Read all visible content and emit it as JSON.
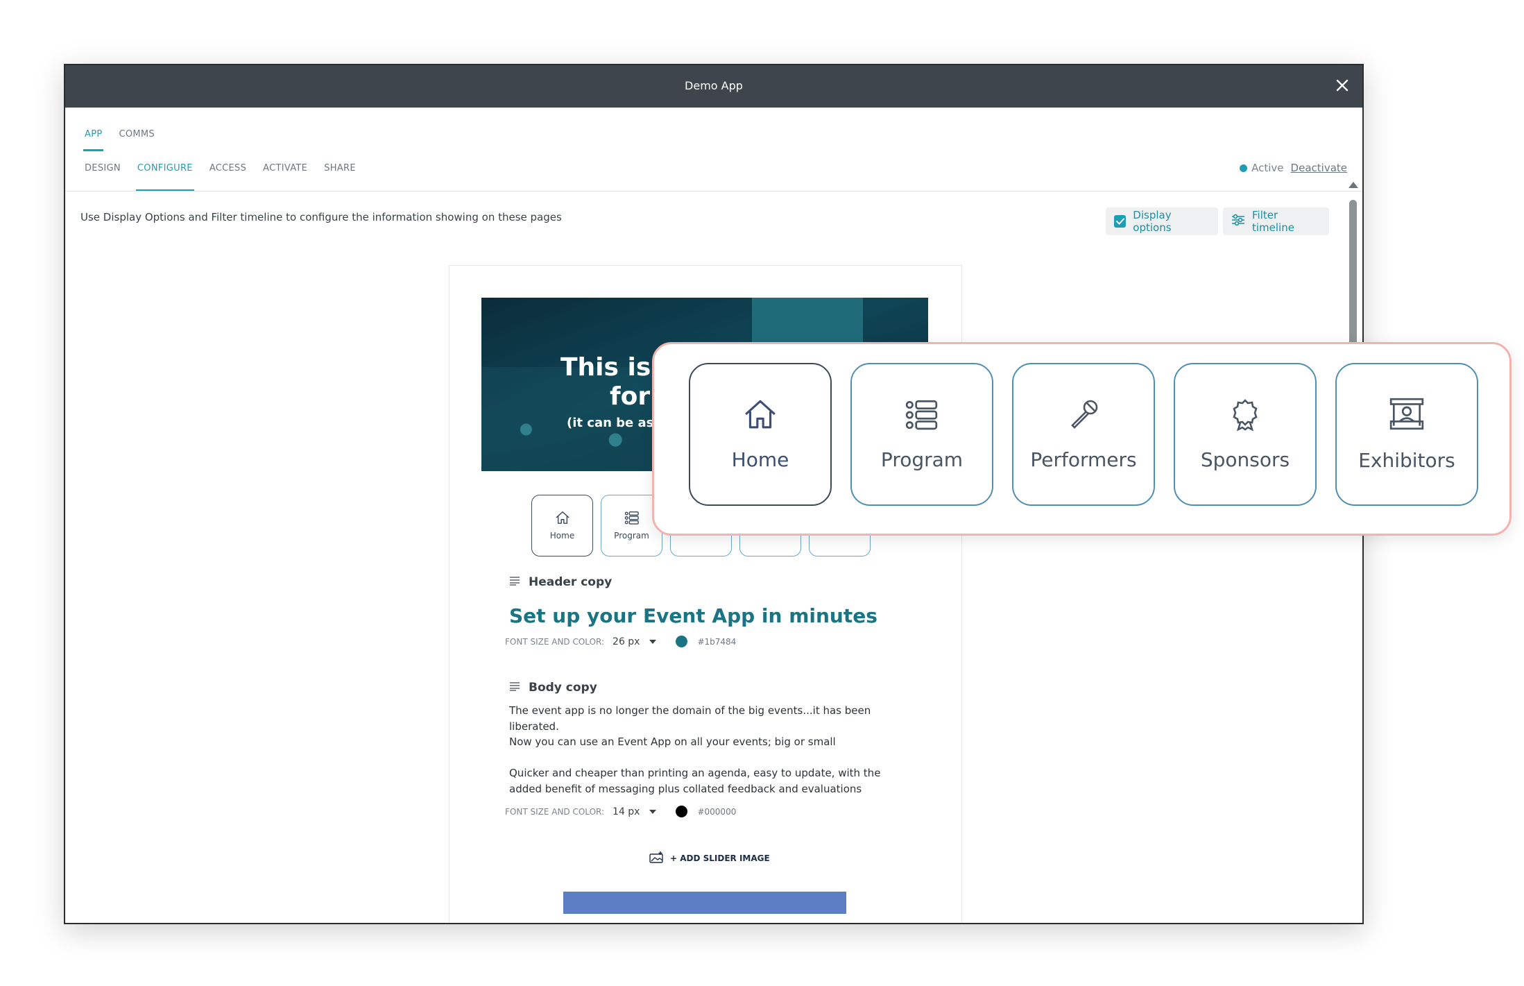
{
  "window": {
    "title": "Demo App"
  },
  "tabs_top": [
    {
      "label": "APP"
    },
    {
      "label": "COMMS"
    }
  ],
  "tabs_sub": [
    {
      "label": "DESIGN"
    },
    {
      "label": "CONFIGURE"
    },
    {
      "label": "ACCESS"
    },
    {
      "label": "ACTIVATE"
    },
    {
      "label": "SHARE"
    }
  ],
  "status": {
    "active_label": "Active",
    "deactivate_label": "Deactivate",
    "active_color": "#1c9fb4"
  },
  "instruction": "Use Display Options and Filter timeline to configure the information showing on these pages",
  "buttons": {
    "display_options": "Display options",
    "filter_timeline": "Filter timeline"
  },
  "hero": {
    "line1": "This is a",
    "line2": "for",
    "line3": "(it can be as r"
  },
  "nav": [
    {
      "label": "Home",
      "icon": "home-icon"
    },
    {
      "label": "Program",
      "icon": "program-icon"
    },
    {
      "label": "Performers",
      "icon": "microphone-icon"
    },
    {
      "label": "Sponsors",
      "icon": "award-icon"
    },
    {
      "label": "Exhibitors",
      "icon": "exhibitor-booth-icon"
    }
  ],
  "header_section": {
    "label": "Header copy",
    "text": "Set up your Event App in minutes",
    "meta_label": "FONT SIZE AND COLOR:",
    "font_size": "26 px",
    "color": "#1b7484",
    "hex": "#1b7484"
  },
  "body_section": {
    "label": "Body copy",
    "paragraphs": [
      "The event app is no longer the domain of the big events...it has been liberated.",
      "Now you can use an Event App on all your events; big or small",
      "Quicker and cheaper than printing an agenda, easy to update, with the added benefit of messaging plus collated feedback and evaluations"
    ],
    "meta_label": "FONT SIZE AND COLOR:",
    "font_size": "14 px",
    "color": "#000000",
    "hex": "#000000"
  },
  "add_slider": "+ ADD SLIDER IMAGE"
}
